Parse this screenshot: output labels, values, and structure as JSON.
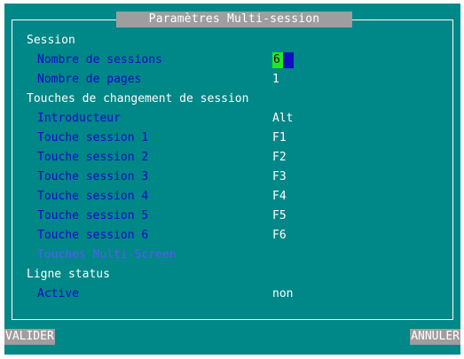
{
  "dialog": {
    "title": "Paramètres Multi-session"
  },
  "sections": {
    "session": "Session",
    "hotkeys": "Touches de changement de session",
    "status": "Ligne status"
  },
  "fields": {
    "nb_sessions_label": "Nombre de sessions",
    "nb_sessions_value": "6",
    "nb_pages_label": "Nombre de pages",
    "nb_pages_value": "1",
    "introducer_label": "Introducteur",
    "introducer_value": "Alt",
    "multiscreen_label": "Touches Multi-Screen",
    "active_label": "Active",
    "active_value": "non"
  },
  "hotkeys": [
    {
      "label": "Touche session 1",
      "value": "F1"
    },
    {
      "label": "Touche session 2",
      "value": "F2"
    },
    {
      "label": "Touche session 3",
      "value": "F3"
    },
    {
      "label": "Touche session 4",
      "value": "F4"
    },
    {
      "label": "Touche session 5",
      "value": "F5"
    },
    {
      "label": "Touche session 6",
      "value": "F6"
    }
  ],
  "buttons": {
    "validate": "VALIDER",
    "cancel": "ANNULER"
  },
  "colors": {
    "background": "#008787",
    "label": "#0a0ac8",
    "disabled_label": "#5a5aff",
    "focus_field": "#22e822",
    "cursor": "#1010c0",
    "button": "#9e9e9e"
  }
}
